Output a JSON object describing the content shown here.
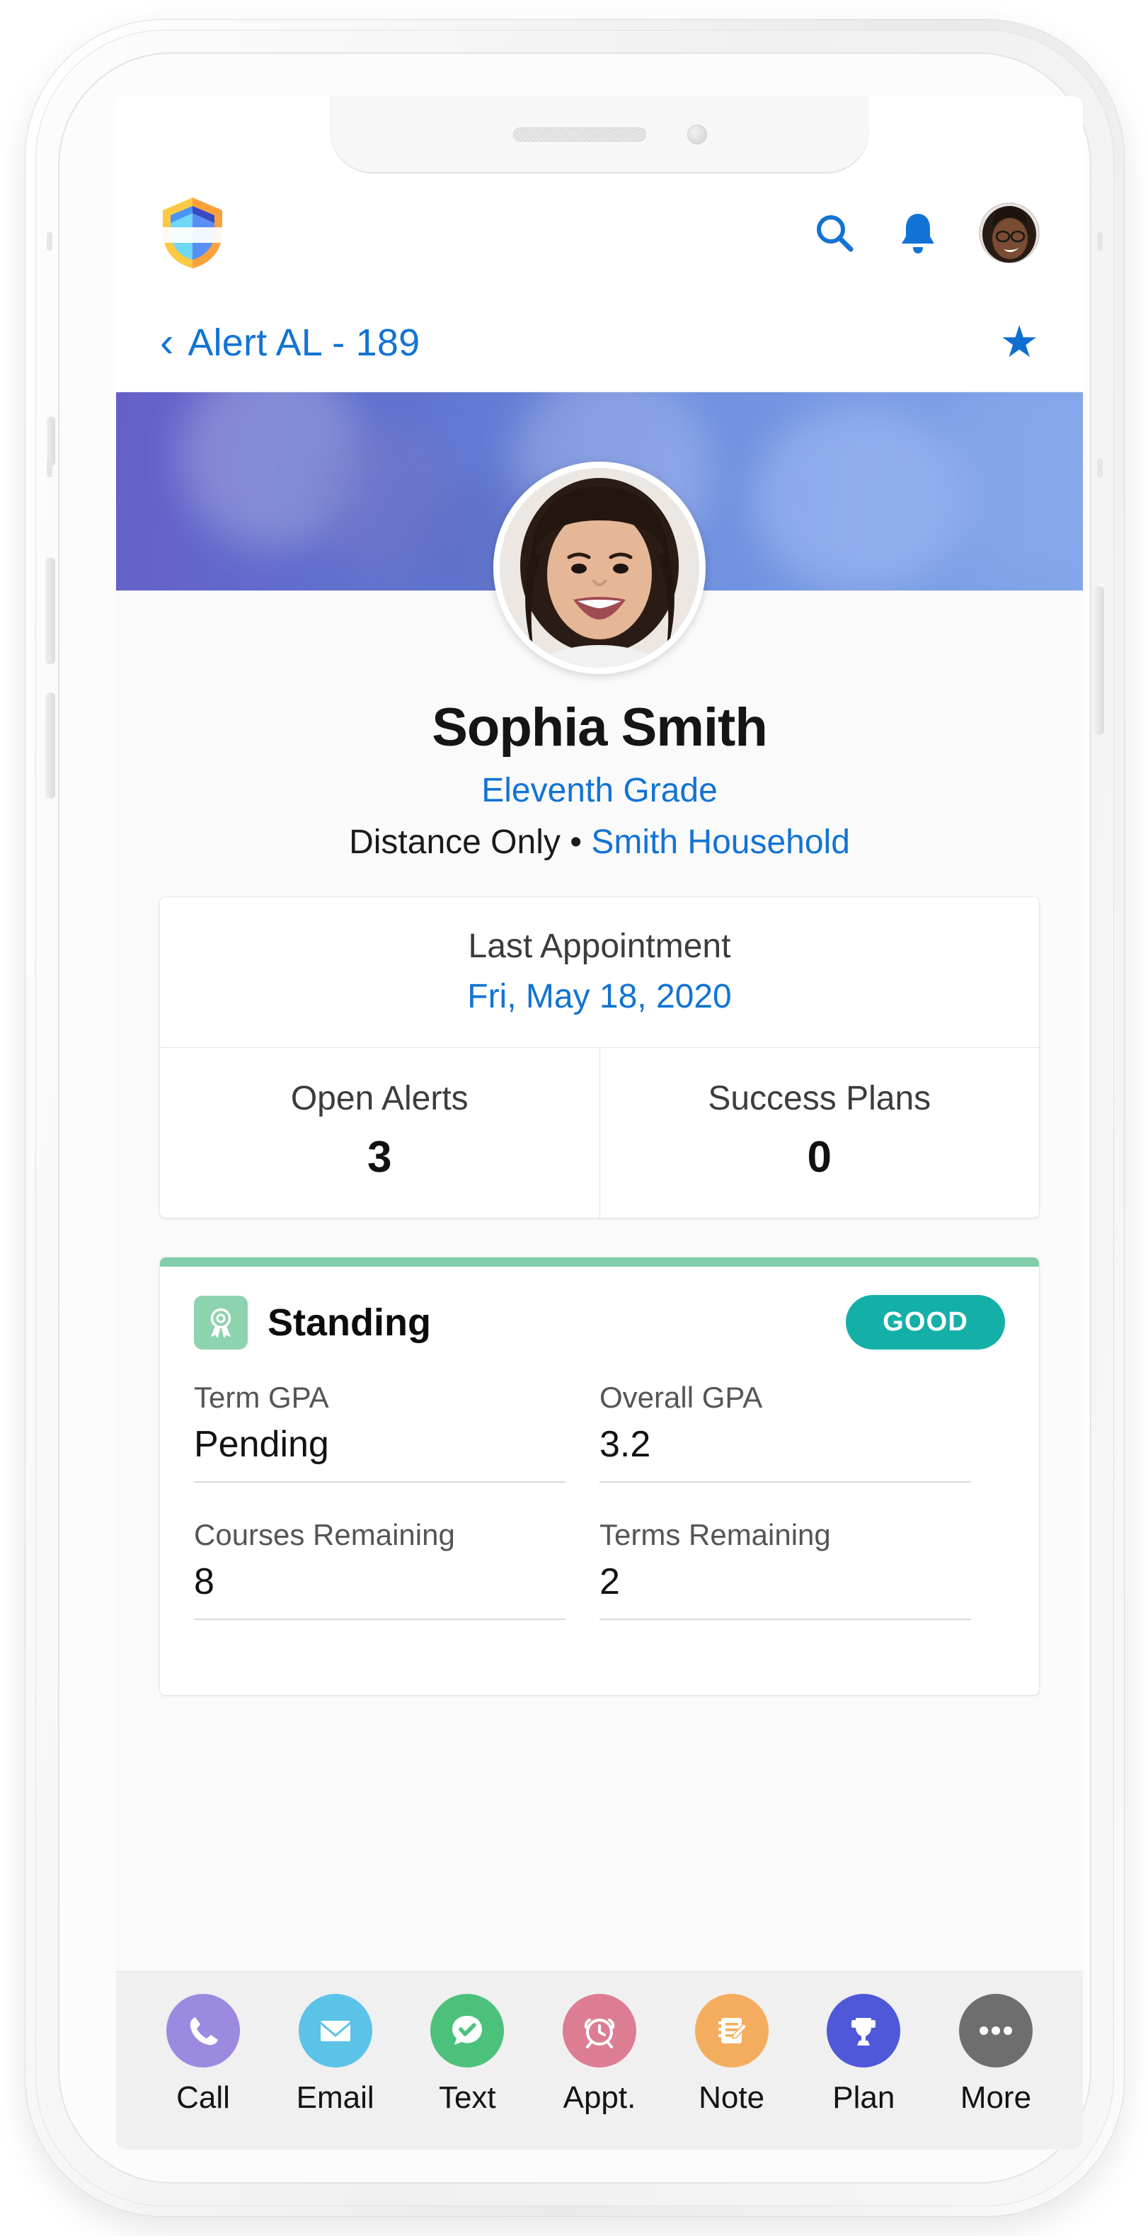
{
  "app": {
    "logo_icon": "shield-logo",
    "header_icons": [
      {
        "name": "search-icon",
        "label": "Search"
      },
      {
        "name": "notifications-bell-icon",
        "label": "Notifications"
      },
      {
        "name": "user-avatar",
        "label": "Account"
      }
    ]
  },
  "nav": {
    "back_icon": "chevron-left-icon",
    "title": "Alert AL - 189",
    "favorite_icon": "star-filled-icon"
  },
  "profile": {
    "avatar_icon": "student-avatar",
    "name": "Sophia Smith",
    "grade": "Eleventh Grade",
    "modality": "Distance Only",
    "separator": "•",
    "household": "Smith Household"
  },
  "stats_card": {
    "last_appointment_label": "Last Appointment",
    "last_appointment_value": "Fri, May 18, 2020",
    "items": [
      {
        "label": "Open Alerts",
        "value": "3"
      },
      {
        "label": "Success Plans",
        "value": "0"
      }
    ]
  },
  "standing_card": {
    "icon": "award-ribbon-icon",
    "title": "Standing",
    "badge": "GOOD",
    "accent_color": "#80ceab",
    "badge_color": "#14b0a8",
    "fields": [
      {
        "label": "Term GPA",
        "value": "Pending"
      },
      {
        "label": "Overall GPA",
        "value": "3.2"
      },
      {
        "label": "Courses Remaining",
        "value": "8"
      },
      {
        "label": "Terms Remaining",
        "value": "2"
      }
    ]
  },
  "action_bar": {
    "actions": [
      {
        "label": "Call",
        "icon": "phone-icon",
        "color": "#9b8ae0"
      },
      {
        "label": "Email",
        "icon": "envelope-icon",
        "color": "#5bc3e8"
      },
      {
        "label": "Text",
        "icon": "chat-check-icon",
        "color": "#4cc17c"
      },
      {
        "label": "Appt.",
        "icon": "alarm-clock-icon",
        "color": "#dd7d93"
      },
      {
        "label": "Note",
        "icon": "note-edit-icon",
        "color": "#f4ad5e"
      },
      {
        "label": "Plan",
        "icon": "trophy-icon",
        "color": "#4e58d8"
      },
      {
        "label": "More",
        "icon": "ellipsis-icon",
        "color": "#6e6e6e"
      }
    ]
  }
}
